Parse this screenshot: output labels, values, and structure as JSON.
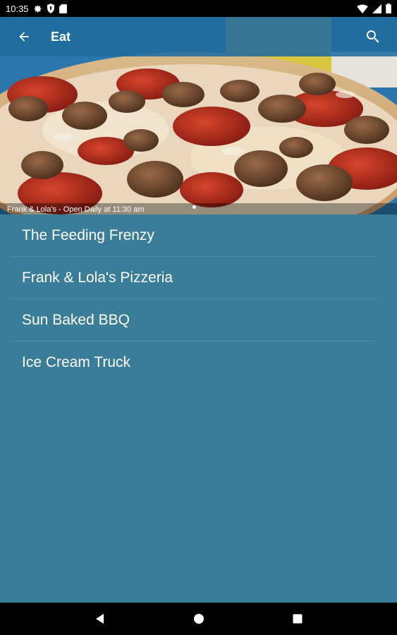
{
  "status_bar": {
    "time": "10:35",
    "left_icons": [
      "gear-icon",
      "shield-icon",
      "sd-card-icon"
    ],
    "right_icons": [
      "wifi-icon",
      "signal-icon",
      "battery-icon"
    ]
  },
  "toolbar": {
    "title": "Eat",
    "back_icon": "arrow-back-icon",
    "search_icon": "search-icon",
    "color": "#1f6c9e"
  },
  "hero": {
    "caption": "Frank & Lola's - Open Daily at 11:30 am"
  },
  "list": {
    "items": [
      {
        "label": "The Feeding Frenzy"
      },
      {
        "label": "Frank & Lola's Pizzeria"
      },
      {
        "label": "Sun Baked BBQ"
      },
      {
        "label": "Ice Cream Truck"
      }
    ]
  },
  "colors": {
    "background": "#3a7d98",
    "text": "#ffffff"
  },
  "nav_bar": {
    "buttons": [
      "back-triangle-icon",
      "home-circle-icon",
      "recents-square-icon"
    ]
  }
}
